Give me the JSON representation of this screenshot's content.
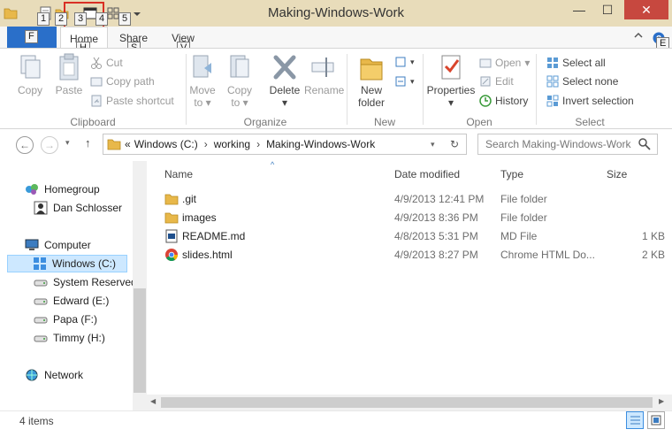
{
  "window": {
    "title": "Making-Windows-Work",
    "minimize": "—",
    "maximize": "☐",
    "close": "✕"
  },
  "keytips": {
    "qat": [
      "1",
      "2",
      "3",
      "4",
      "5"
    ],
    "file": "F",
    "home": "H",
    "share": "S",
    "view": "V",
    "help": "E"
  },
  "ribbon": {
    "tabs": {
      "file": "F",
      "home": "Home",
      "share": "Share",
      "view": "View"
    },
    "clipboard": {
      "label": "Clipboard",
      "copy": "Copy",
      "paste": "Paste",
      "cut": "Cut",
      "copy_path": "Copy path",
      "paste_shortcut": "Paste shortcut"
    },
    "organize": {
      "label": "Organize",
      "move_to": "Move",
      "move_to_2": "to",
      "copy_to": "Copy",
      "copy_to_2": "to",
      "delete": "Delete",
      "rename": "Rename"
    },
    "new": {
      "label": "New",
      "new_folder": "New",
      "new_folder_2": "folder"
    },
    "open": {
      "label": "Open",
      "properties": "Properties",
      "open": "Open",
      "edit": "Edit",
      "history": "History"
    },
    "select": {
      "label": "Select",
      "select_all": "Select all",
      "select_none": "Select none",
      "invert_selection": "Invert selection"
    }
  },
  "address": {
    "prefix": "«",
    "crumbs": [
      "Windows (C:)",
      "working",
      "Making-Windows-Work"
    ],
    "search_placeholder": "Search Making-Windows-Work"
  },
  "nav": {
    "homegroup": "Homegroup",
    "user": "Dan Schlosser",
    "computer": "Computer",
    "drives": [
      "Windows (C:)",
      "System Reserved",
      "Edward (E:)",
      "Papa (F:)",
      "Timmy (H:)"
    ],
    "network": "Network"
  },
  "columns": {
    "name": "Name",
    "date": "Date modified",
    "type": "Type",
    "size": "Size"
  },
  "files": [
    {
      "name": ".git",
      "date": "4/9/2013 12:41 PM",
      "type": "File folder",
      "size": "",
      "icon": "folder-icon"
    },
    {
      "name": "images",
      "date": "4/9/2013 8:36 PM",
      "type": "File folder",
      "size": "",
      "icon": "folder-icon"
    },
    {
      "name": "README.md",
      "date": "4/8/2013 5:31 PM",
      "type": "MD File",
      "size": "1 KB",
      "icon": "md-file-icon"
    },
    {
      "name": "slides.html",
      "date": "4/9/2013 8:27 PM",
      "type": "Chrome HTML Do...",
      "size": "2 KB",
      "icon": "chrome-icon"
    }
  ],
  "status": {
    "count": "4 items"
  },
  "colors": {
    "accent": "#2a6fc9",
    "folder": "#e8b84a",
    "selection": "#cde8ff",
    "title_bg": "#e8dcba",
    "close": "#c7483f",
    "highlight_box": "#d93025"
  }
}
